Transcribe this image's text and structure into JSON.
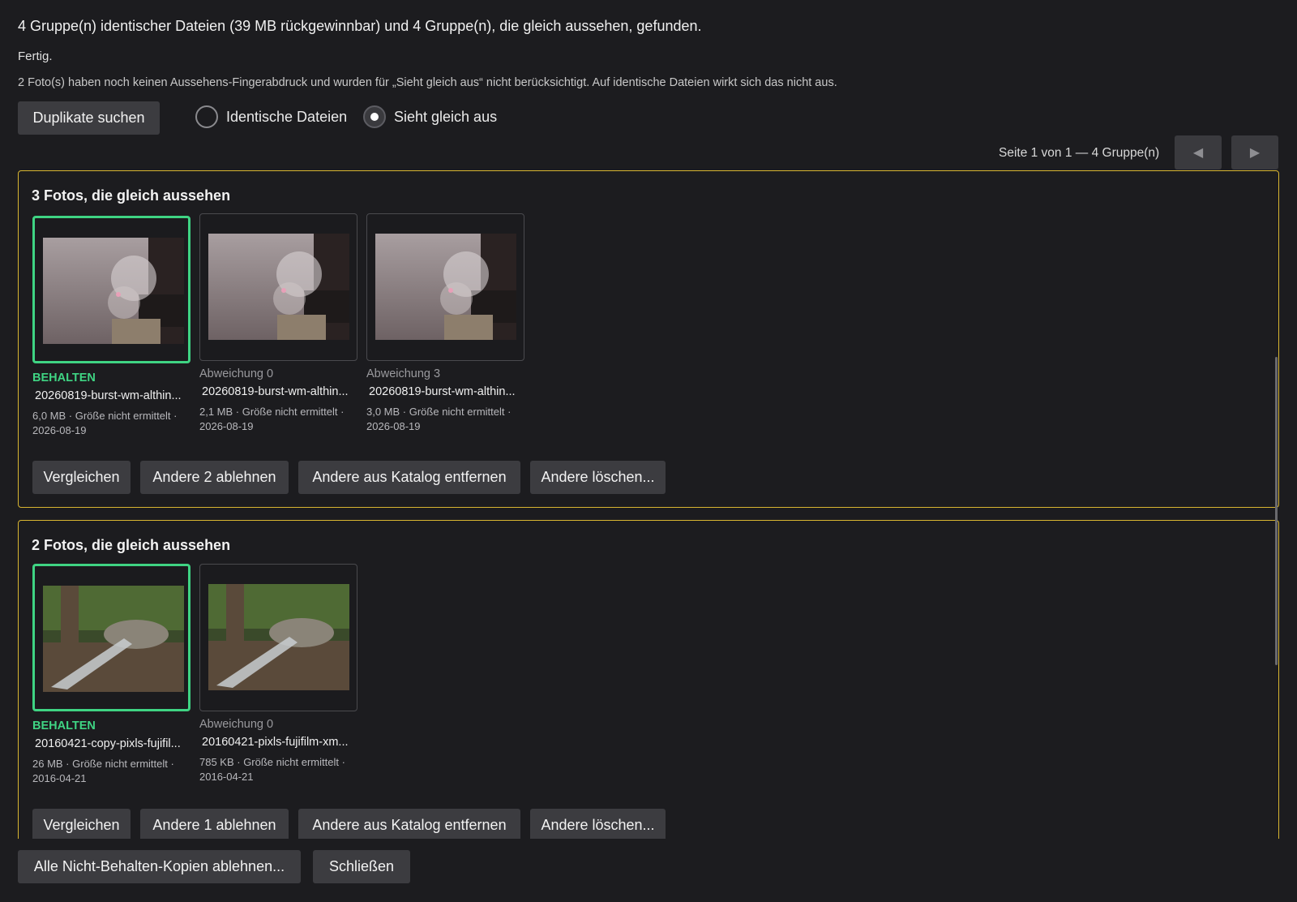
{
  "summary": "4 Gruppe(n) identischer Dateien (39 MB rückgewinnbar) und 4 Gruppe(n), die gleich aussehen, gefunden.",
  "status": "Fertig.",
  "note": "2 Foto(s) haben noch keinen Aussehens-Fingerabdruck und wurden für „Sieht gleich aus“ nicht berücksichtigt. Auf identische Dateien wirkt sich das nicht aus.",
  "toolbar": {
    "search_button": "Duplikate suchen",
    "mode_options": [
      {
        "label": "Identische Dateien",
        "selected": false
      },
      {
        "label": "Sieht gleich aus",
        "selected": true
      }
    ]
  },
  "pager": {
    "text": "Seite 1 von 1 — 4 Gruppe(n)",
    "prev_icon": "◀",
    "next_icon": "▶"
  },
  "groups": [
    {
      "title": "3 Fotos, die gleich aussehen",
      "photos": [
        {
          "badge": "BEHALTEN",
          "keep": true,
          "filename": "20260819-burst-wm-althin...",
          "meta": "6,0 MB · Größe nicht ermittelt · 2026-08-19"
        },
        {
          "badge": "Abweichung 0",
          "keep": false,
          "filename": "20260819-burst-wm-althin...",
          "meta": "2,1 MB · Größe nicht ermittelt · 2026-08-19"
        },
        {
          "badge": "Abweichung 3",
          "keep": false,
          "filename": "20260819-burst-wm-althin...",
          "meta": "3,0 MB · Größe nicht ermittelt · 2026-08-19"
        }
      ],
      "actions": {
        "compare": "Vergleichen",
        "reject": "Andere 2 ablehnen",
        "remove": "Andere aus Katalog entfernen",
        "delete": "Andere löschen..."
      }
    },
    {
      "title": "2 Fotos, die gleich aussehen",
      "photos": [
        {
          "badge": "BEHALTEN",
          "keep": true,
          "filename": "20160421-copy-pixls-fujifil...",
          "meta": "26 MB · Größe nicht ermittelt · 2016-04-21"
        },
        {
          "badge": "Abweichung 0",
          "keep": false,
          "filename": "20160421-pixls-fujifilm-xm...",
          "meta": "785 KB · Größe nicht ermittelt · 2016-04-21"
        }
      ],
      "actions": {
        "compare": "Vergleichen",
        "reject": "Andere 1 ablehnen",
        "remove": "Andere aus Katalog entfernen",
        "delete": "Andere löschen..."
      }
    }
  ],
  "footer": {
    "reject_all": "Alle Nicht-Behalten-Kopien ablehnen...",
    "close": "Schließen"
  },
  "colors": {
    "background": "#1c1c1f",
    "group_border": "#d8b531",
    "keep_accent": "#3fd483",
    "button_bg": "#3c3c40"
  }
}
